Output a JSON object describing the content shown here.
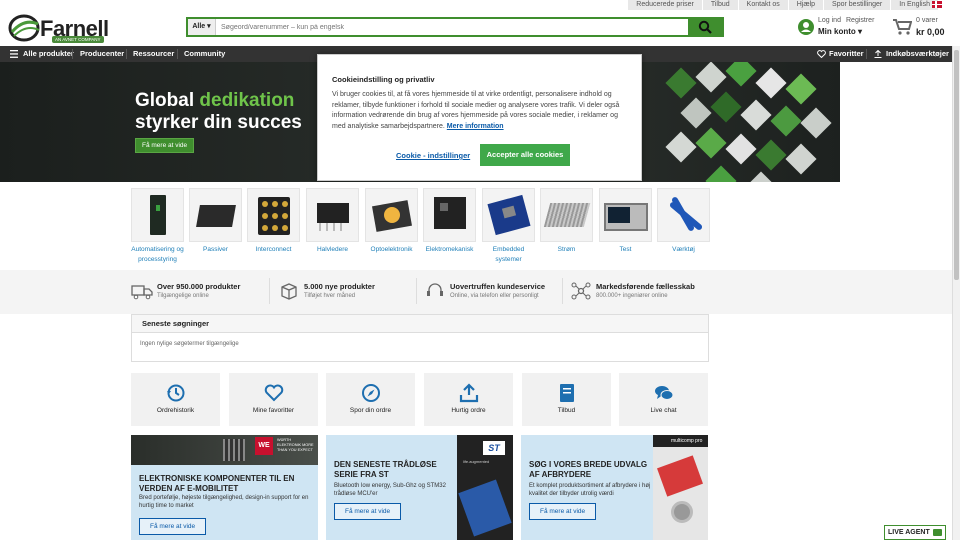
{
  "topbar": {
    "links": [
      "Reducerede priser",
      "Tilbud",
      "Kontakt os",
      "Hjælp",
      "Spor bestillinger",
      "In English"
    ]
  },
  "header": {
    "logo_text": "Farnell",
    "logo_sub": "AN AVNET COMPANY",
    "search_category": "Alle",
    "search_placeholder": "Søgeord/varenummer – kun på engelsk",
    "login": "Log ind",
    "register": "Registrer",
    "my_account": "Min konto",
    "cart_count": "0 varer",
    "cart_total": "kr 0,00"
  },
  "nav": {
    "all_products": "Alle produkter",
    "items": [
      "Producenter",
      "Ressourcer",
      "Community"
    ],
    "favorites": "Favoritter",
    "tools": "Indkøbsværktøjer"
  },
  "hero": {
    "line1_a": "Global ",
    "line1_b": "dedikation",
    "line2": "styrker din succes",
    "cta": "Få mere at vide"
  },
  "cookie": {
    "title": "Cookieindstilling og privatliv",
    "body": "Vi bruger cookies til, at få vores hjemmeside til at virke ordentligt, personalisere indhold og reklamer, tilbyde funktioner i forhold til sociale medier og analysere vores trafik. Vi deler også information vedrørende din brug af vores hjemmeside på vores sociale medier, i reklamer og med analytiske samarbejdspartnere.",
    "more": "Mere information",
    "settings": "Cookie - indstillinger",
    "accept": "Accepter alle cookies"
  },
  "categories": [
    {
      "label": "Automatisering og processtyring"
    },
    {
      "label": "Passiver"
    },
    {
      "label": "Interconnect"
    },
    {
      "label": "Halvledere"
    },
    {
      "label": "Optoelektronik"
    },
    {
      "label": "Elektromekanisk"
    },
    {
      "label": "Embedded systemer"
    },
    {
      "label": "Strøm"
    },
    {
      "label": "Test"
    },
    {
      "label": "Værktøj"
    }
  ],
  "usp": [
    {
      "title": "Over 950.000 produkter",
      "sub": "Tilgængelige online"
    },
    {
      "title": "5.000 nye produkter",
      "sub": "Tilføjet hver måned"
    },
    {
      "title": "Uovertruffen kundeservice",
      "sub": "Online, via telefon eller personligt"
    },
    {
      "title": "Markedsførende fællesskab",
      "sub": "800.000+ ingeniører online"
    }
  ],
  "recent": {
    "title": "Seneste søgninger",
    "empty": "Ingen nylige søgetermer tilgængelige"
  },
  "quick": [
    "Ordrehistorik",
    "Mine favoritter",
    "Spor din ordre",
    "Hurtig ordre",
    "Tilbud",
    "Live chat"
  ],
  "promos": [
    {
      "title": "ELEKTRONISKE KOMPONENTER TIL EN VERDEN AF E-MOBILITET",
      "desc": "Bred portefølje, højeste tilgængelighed, design-in support for en hurtig time to market",
      "button": "Få mere at vide",
      "brand": "WÜRTH ELEKTRONIK MORE THAN YOU EXPECT"
    },
    {
      "title": "DEN SENESTE TRÅDLØSE SERIE FRA ST",
      "desc": "Bluetooth low energy, Sub-Ghz og STM32 trådløse MCU'er",
      "button": "Få mere at vide",
      "brand": "life.augmented"
    },
    {
      "title": "SØG I VORES BREDE UDVALG AF AFBRYDERE",
      "desc": "Et komplet produktsortiment af afbrydere i høj kvalitet der tilbyder utrolig værdi",
      "button": "Få mere at vide",
      "brand": "multicomp pro"
    }
  ],
  "live_agent": "LIVE AGENT",
  "colors": {
    "brand_green": "#3f8e2e",
    "link_blue": "#1e7fb8",
    "nav_dark": "#333333"
  }
}
